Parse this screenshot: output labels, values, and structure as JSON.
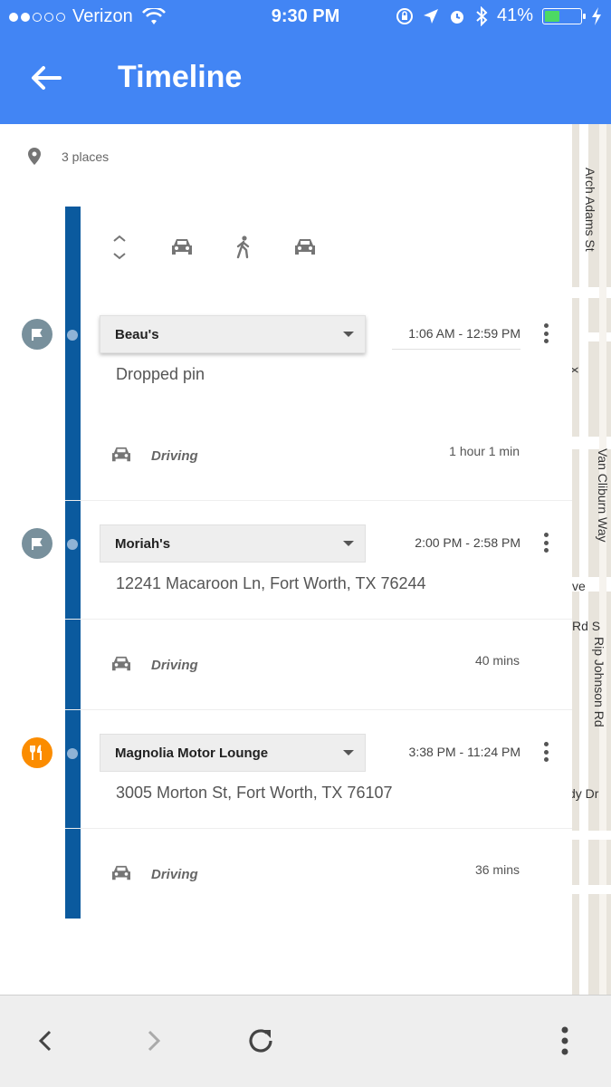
{
  "status_bar": {
    "carrier": "Verizon",
    "time": "9:30 PM",
    "battery": "41%",
    "battery_level": 0.41
  },
  "app_bar": {
    "title": "Timeline",
    "back_icon": "arrow-back-icon",
    "color": "#4285f4"
  },
  "summary": {
    "places_count_label": "3 places",
    "icon": "location-pin-icon"
  },
  "mode_toolbar": {
    "icons": [
      "expand-collapse-icon",
      "car-icon",
      "walk-icon",
      "car-icon"
    ]
  },
  "timeline": [
    {
      "place": "Beau's",
      "time_range": "1:06 AM - 12:59 PM",
      "address": "Dropped pin",
      "badge_icon": "flag-icon",
      "badge_color": "#78909c",
      "travel_mode": "Driving",
      "duration": "1 hour 1 min"
    },
    {
      "place": "Moriah's",
      "time_range": "2:00 PM - 2:58 PM",
      "address": "12241 Macaroon Ln, Fort Worth, TX 76244",
      "badge_icon": "flag-icon",
      "badge_color": "#78909c",
      "travel_mode": "Driving",
      "duration": "40 mins"
    },
    {
      "place": "Magnolia Motor Lounge",
      "time_range": "3:38 PM - 11:24 PM",
      "address": "3005 Morton St, Fort Worth, TX 76107",
      "badge_icon": "restaurant-icon",
      "badge_color": "#fb8c00",
      "travel_mode": "Driving",
      "duration": "36 mins"
    }
  ],
  "map_labels": {
    "arch_adams": "Arch Adams St",
    "van_cliburn": "Van Cliburn Way",
    "ve": "ve",
    "rd_s": "Rd S",
    "rip_johnson": "Rip Johnson Rd",
    "dy_dr": "dy Dr",
    "x": "x"
  },
  "bottom_bar": {
    "buttons": [
      "back-icon",
      "forward-icon",
      "reload-icon",
      "more-vert-icon"
    ]
  }
}
